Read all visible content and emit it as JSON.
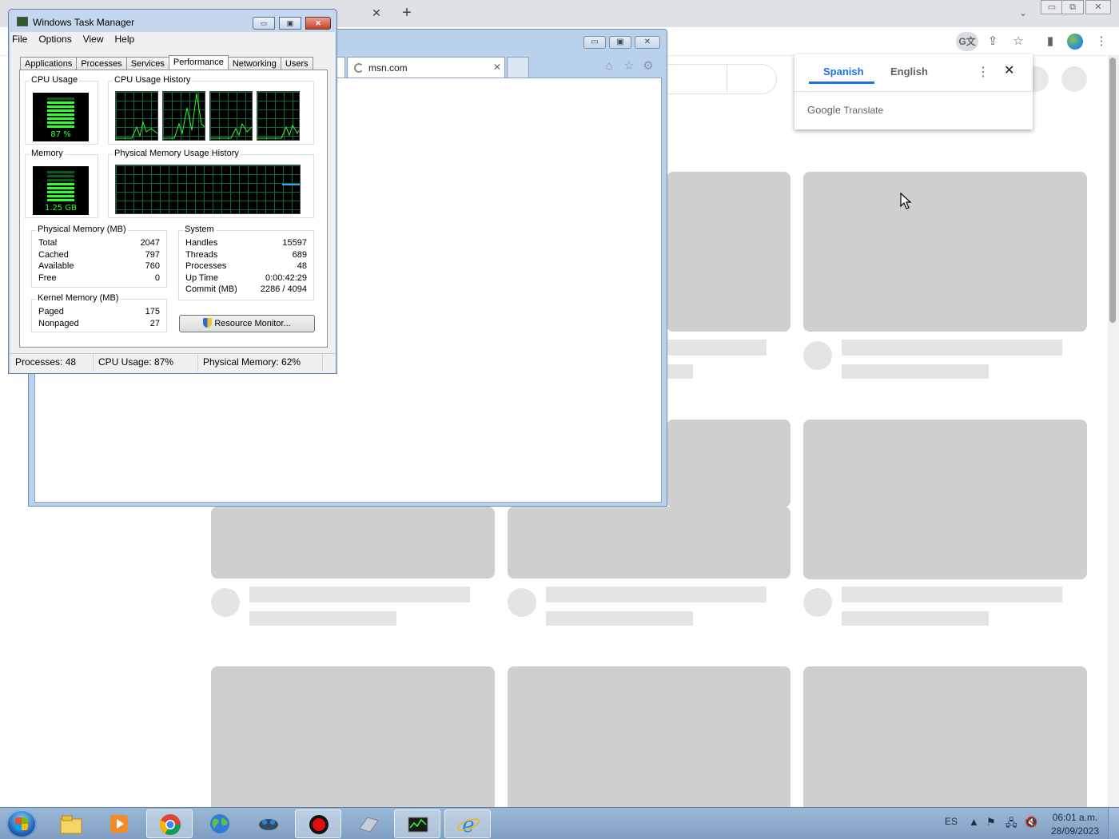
{
  "chrome": {
    "tab_close_glyph": "✕",
    "new_tab_glyph": "+",
    "tab_search_glyph": "⌄",
    "window_buttons": [
      "▭",
      "⧉",
      "✕"
    ],
    "toolbar_icons": {
      "translate": "G文",
      "share": "⇪",
      "bookmark": "☆",
      "sidepanel": "▮",
      "menu": "⋮"
    },
    "translate_popup": {
      "tab_source": "Spanish",
      "tab_target": "English",
      "more_glyph": "⋮",
      "close_glyph": "✕",
      "brand_google": "Google",
      "brand_product": "Translate"
    }
  },
  "ie": {
    "tab_label": "msn.com",
    "tab_close_glyph": "✕",
    "window_buttons": [
      "▭",
      "▣",
      "✕"
    ],
    "command_icons": {
      "home": "⌂",
      "favorites": "☆",
      "tools": "⚙"
    }
  },
  "task_manager": {
    "title": "Windows Task Manager",
    "caption_buttons": [
      "▭",
      "▣",
      "✕"
    ],
    "menu": [
      "File",
      "Options",
      "View",
      "Help"
    ],
    "tabs": [
      "Applications",
      "Processes",
      "Services",
      "Performance",
      "Networking",
      "Users"
    ],
    "active_tab": "Performance",
    "cpu_usage": {
      "label": "CPU Usage",
      "value": "87 %",
      "level": 0.87
    },
    "cpu_history": {
      "label": "CPU Usage History",
      "cores": 4
    },
    "memory": {
      "label": "Memory",
      "value": "1.25 GB",
      "level": 0.62
    },
    "memory_history": {
      "label": "Physical Memory Usage History"
    },
    "physical_memory": {
      "label": "Physical Memory (MB)",
      "rows": [
        {
          "k": "Total",
          "v": "2047"
        },
        {
          "k": "Cached",
          "v": "797"
        },
        {
          "k": "Available",
          "v": "760"
        },
        {
          "k": "Free",
          "v": "0"
        }
      ]
    },
    "kernel_memory": {
      "label": "Kernel Memory (MB)",
      "rows": [
        {
          "k": "Paged",
          "v": "175"
        },
        {
          "k": "Nonpaged",
          "v": "27"
        }
      ]
    },
    "system": {
      "label": "System",
      "rows": [
        {
          "k": "Handles",
          "v": "15597"
        },
        {
          "k": "Threads",
          "v": "689"
        },
        {
          "k": "Processes",
          "v": "48"
        },
        {
          "k": "Up Time",
          "v": "0:00:42:29"
        },
        {
          "k": "Commit (MB)",
          "v": "2286 / 4094"
        }
      ]
    },
    "resource_monitor_button": "Resource Monitor...",
    "status": {
      "processes": "Processes: 48",
      "cpu": "CPU Usage: 87%",
      "memory": "Physical Memory: 62%"
    }
  },
  "taskbar": {
    "language": "ES",
    "tray_icons": {
      "expand": "▲",
      "flag": "⚑",
      "network": "🖧",
      "volume": "🔇"
    },
    "clock_time": "06:01 a.m.",
    "clock_date": "28/09/2023"
  },
  "colors": {
    "meter_green": "#2cff2c",
    "graph_grid": "#0b6b3a",
    "translate_blue": "#1a73e8",
    "skeleton": "#cfcfcf"
  }
}
